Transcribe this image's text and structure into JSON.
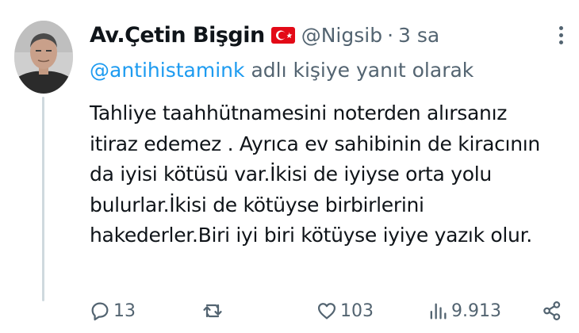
{
  "tweet": {
    "author_name": "Av.Çetin Bişgin",
    "flag_icon": "turkey-flag-icon",
    "handle": "@Nigsib",
    "separator": "·",
    "time": "3 sa",
    "reply_to": {
      "mention": "@antihistamink",
      "suffix": "adlı kişiye yanıt olarak"
    },
    "text_lines": [
      "Tahliye taahhütnamesini noterden alırsanız",
      "itiraz edemez . Ayrıca ev sahibinin de kiracının",
      "da iyisi kötüsü var.İkisi de iyiyse orta yolu",
      "bulurlar.İkisi de kötüyse birbirlerini",
      "hakederler.Biri iyi biri kötüyse iyiye yazık olur."
    ]
  },
  "actions": {
    "reply": {
      "icon": "reply-icon",
      "count": "13"
    },
    "retweet": {
      "icon": "retweet-icon",
      "count": ""
    },
    "like": {
      "icon": "heart-icon",
      "count": "103"
    },
    "views": {
      "icon": "views-icon",
      "count": "9.913"
    },
    "share": {
      "icon": "share-icon"
    }
  },
  "colors": {
    "link": "#1d9bf0",
    "secondary_text": "#536471",
    "primary_text": "#0f1419",
    "flag_red": "#e30a17"
  }
}
